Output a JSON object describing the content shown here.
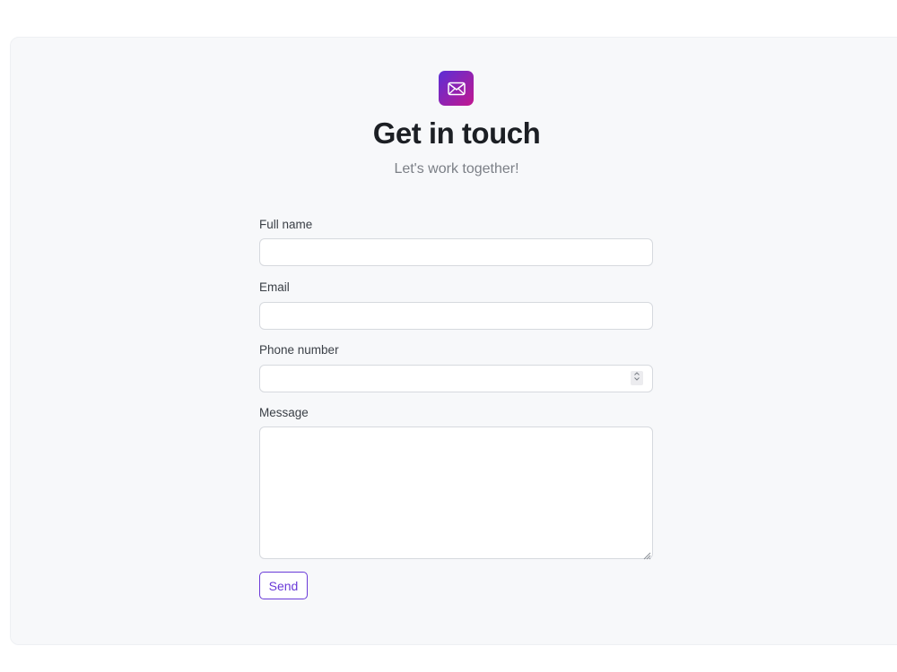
{
  "header": {
    "icon": "envelope-icon",
    "title": "Get in touch",
    "subtitle": "Let's work together!"
  },
  "form": {
    "full_name": {
      "label": "Full name",
      "value": "",
      "placeholder": ""
    },
    "email": {
      "label": "Email",
      "value": "",
      "placeholder": ""
    },
    "phone": {
      "label": "Phone number",
      "value": "",
      "placeholder": ""
    },
    "message": {
      "label": "Message",
      "value": ""
    },
    "send_label": "Send"
  },
  "colors": {
    "accent": "#6a3ad8",
    "logo_gradient_start": "#5b2fd6",
    "logo_gradient_end": "#c2178f",
    "card_background": "#f7f8fa"
  }
}
